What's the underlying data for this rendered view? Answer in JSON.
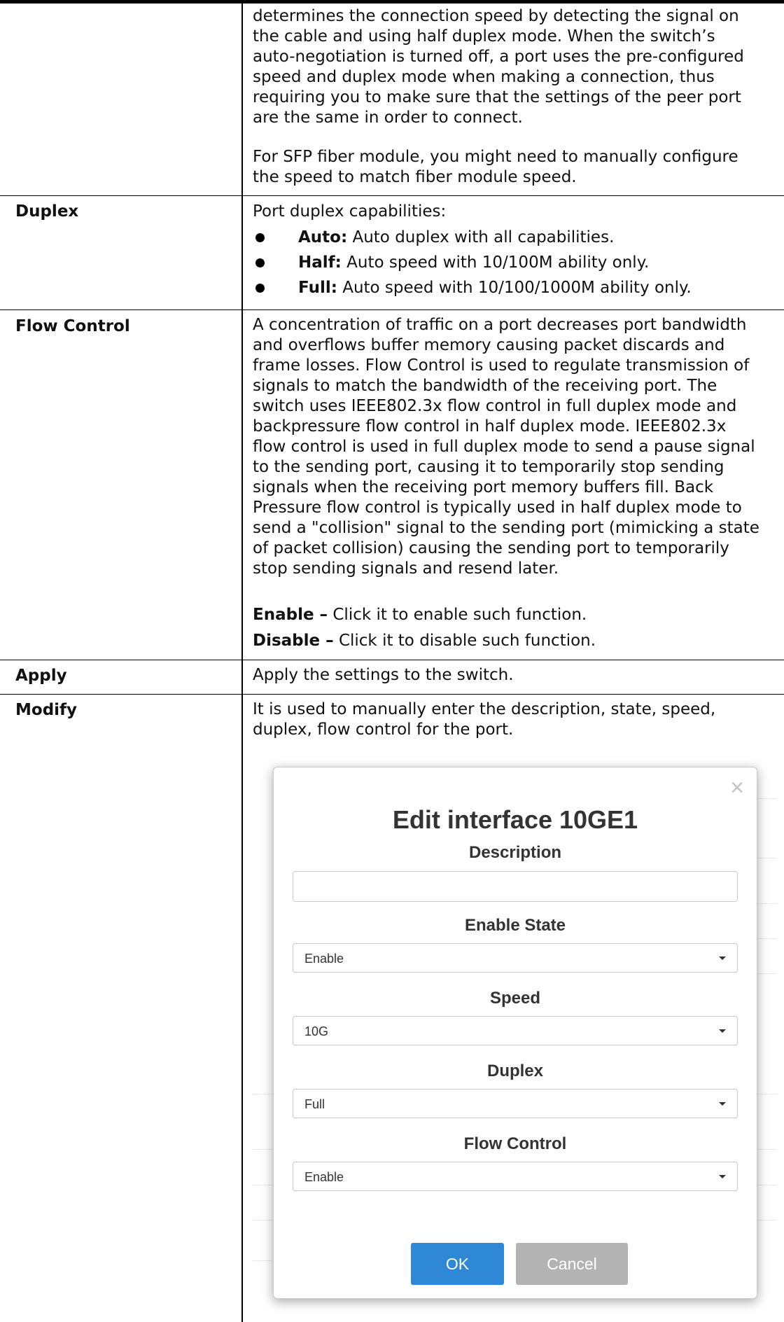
{
  "intro": {
    "lines": [
      "determines the connection speed by detecting the signal on",
      "the cable and using half duplex mode. When the switch’s",
      "auto-negotiation is turned off, a port uses the pre-configured",
      "speed and duplex mode when making a connection, thus",
      "requiring you to make sure that the settings of the peer port",
      "are the same in order to connect."
    ],
    "sfp_lines": [
      "For SFP fiber module, you might need to manually configure",
      "the speed to match fiber module speed."
    ]
  },
  "duplex": {
    "label": "Duplex",
    "heading": "Port duplex capabilities:",
    "items": [
      {
        "term": "Auto:",
        "text": " Auto duplex with all capabilities."
      },
      {
        "term": "Half:",
        "text": " Auto speed with 10/100M ability only."
      },
      {
        "term": "Full:",
        "text": " Auto speed with 10/100/1000M ability only."
      }
    ]
  },
  "flow_control": {
    "label": "Flow Control",
    "lines": [
      "A concentration of traffic on a port decreases port bandwidth",
      "and overflows buffer memory causing packet discards and",
      "frame losses. Flow Control is used to regulate transmission of",
      "signals to match the bandwidth of the receiving port. The",
      "switch uses IEEE802.3x flow control in full duplex mode and",
      "backpressure flow control in half duplex mode. IEEE802.3x",
      "flow control is used in full duplex mode to send a pause signal",
      "to the sending port, causing it to temporarily stop sending",
      "signals when the receiving port memory buffers fill. Back",
      "Pressure flow control is typically used in half duplex mode to",
      "send a \"collision\" signal to the sending port (mimicking a state",
      "of packet collision) causing the sending port to temporarily",
      "stop sending signals and resend later."
    ],
    "enable_term": "Enable –",
    "enable_text": " Click it to enable such function.",
    "disable_term": "Disable –",
    "disable_text": " Click it to disable such function."
  },
  "apply": {
    "label": "Apply",
    "text": "Apply the settings to the switch."
  },
  "modify": {
    "label": "Modify",
    "lines": [
      "It is used to manually enter the description, state, speed,",
      "duplex, flow control for the port."
    ]
  },
  "modal": {
    "close_glyph": "×",
    "title": "Edit interface 10GE1",
    "description_label": "Description",
    "description_value": "",
    "enable_state_label": "Enable State",
    "enable_state_value": "Enable",
    "speed_label": "Speed",
    "speed_value": "10G",
    "duplex_label": "Duplex",
    "duplex_value": "Full",
    "flow_control_label": "Flow Control",
    "flow_control_value": "Enable",
    "ok_label": "OK",
    "cancel_label": "Cancel"
  },
  "colors": {
    "ok_button": "#2f88d6",
    "cancel_button": "#b3b3b3"
  }
}
